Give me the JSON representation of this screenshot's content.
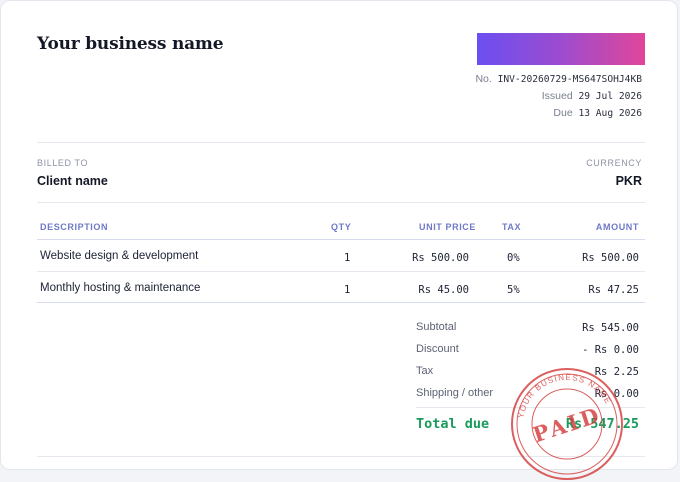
{
  "business_name": "Your business name",
  "invoice": {
    "number_label": "No.",
    "number": "INV-20260729-MS647SOHJ4KB",
    "issued_label": "Issued",
    "issued": "29 Jul 2026",
    "due_label": "Due",
    "due": "13 Aug 2026"
  },
  "billed_to": {
    "label": "BILLED TO",
    "value": "Client name"
  },
  "currency": {
    "label": "CURRENCY",
    "value": "PKR"
  },
  "table": {
    "headers": {
      "description": "DESCRIPTION",
      "qty": "QTY",
      "unit_price": "UNIT PRICE",
      "tax": "TAX",
      "amount": "AMOUNT"
    },
    "rows": [
      {
        "description": "Website design & development",
        "qty": "1",
        "unit_price": "Rs 500.00",
        "tax": "0%",
        "amount": "Rs 500.00"
      },
      {
        "description": "Monthly hosting & maintenance",
        "qty": "1",
        "unit_price": "Rs 45.00",
        "tax": "5%",
        "amount": "Rs 47.25"
      }
    ]
  },
  "totals": {
    "subtotal_label": "Subtotal",
    "subtotal": "Rs 545.00",
    "discount_label": "Discount",
    "discount": "- Rs 0.00",
    "tax_label": "Tax",
    "tax": "Rs 2.25",
    "shipping_label": "Shipping / other",
    "shipping": "Rs 0.00",
    "total_label": "Total due",
    "total": "Rs 547.25"
  },
  "stamp": {
    "text": "PAID",
    "ring_text": "YOUR BUSINESS NAME",
    "color": "#d43c3c"
  },
  "colors": {
    "accent": "#6f79c7",
    "total": "#1a9a5b",
    "logo_start": "#6b4ff2",
    "logo_end": "#e0469a"
  }
}
